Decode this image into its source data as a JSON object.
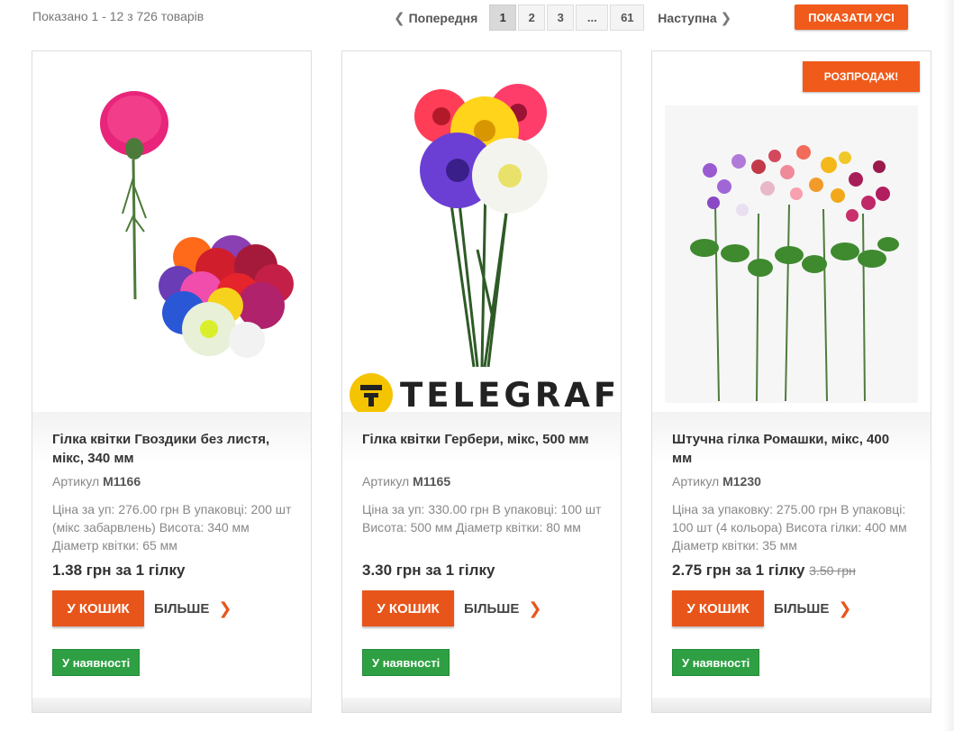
{
  "listing": {
    "showing": "Показано 1 - 12 з 726 товарів"
  },
  "pagination": {
    "prev_label": "Попередня",
    "next_label": "Наступна",
    "pages": [
      "1",
      "2",
      "3",
      "...",
      "61"
    ],
    "current": "1"
  },
  "show_all_label": "ПОКАЗАТИ УСІ",
  "products": [
    {
      "title": "Гілка квітки Гвоздики без листя, мікс, 340 мм",
      "sku_label": "Артикул",
      "sku": "M1166",
      "description": "Ціна за уп: 276.00 грн В упаковці: 200 шт (мікс забарвлень) Висота: 340 мм Діаметр квітки: 65 мм",
      "price": "1.38 грн за 1 гілку",
      "cart_label": "У КОШИК",
      "more_label": "БІЛЬШЕ",
      "stock": "У наявності"
    },
    {
      "title": "Гілка квітки Гербери, мікс, 500 мм",
      "sku_label": "Артикул",
      "sku": "M1165",
      "description": "Ціна за уп: 330.00 грн В упаковці: 100 шт Висота: 500 мм Діаметр квітки: 80 мм",
      "price": "3.30 грн за 1 гілку",
      "cart_label": "У КОШИК",
      "more_label": "БІЛЬШЕ",
      "stock": "У наявності",
      "watermark": "TELEGRAF"
    },
    {
      "title": "Штучна гілка Ромашки, мікс, 400 мм",
      "sku_label": "Артикул",
      "sku": "M1230",
      "description": "Ціна за упаковку: 275.00 грн В упаковці: 100 шт (4 кольора) Висота гілки: 400 мм Діаметр квітки: 35 мм",
      "price": "2.75 грн за 1 гілку",
      "old_price": "3.50 грн",
      "cart_label": "У КОШИК",
      "more_label": "БІЛЬШЕ",
      "stock": "У наявності",
      "badge": "РОЗПРОДАЖ!"
    }
  ],
  "icons": {
    "prev": "chevron-left-icon",
    "next": "chevron-right-icon",
    "more": "chevron-right-icon"
  },
  "colors": {
    "accent": "#e8551b",
    "stock": "#2ea043",
    "watermark_circle": "#f5c400"
  }
}
